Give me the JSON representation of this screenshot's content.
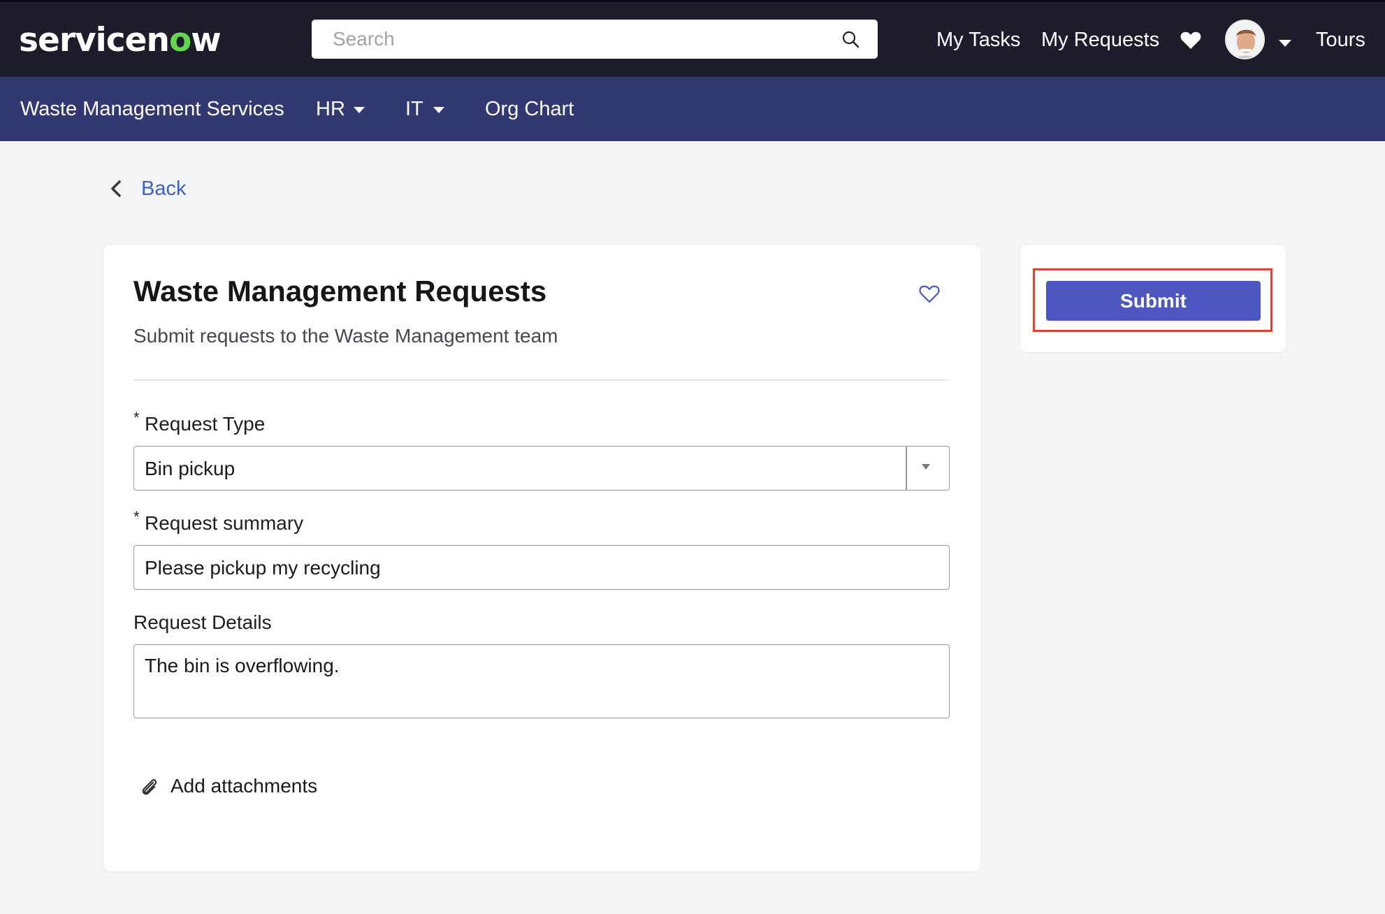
{
  "header": {
    "logo_text_a": "servicen",
    "logo_text_b": "o",
    "logo_text_c": "w",
    "search_placeholder": "Search",
    "links": {
      "tasks": "My Tasks",
      "requests": "My Requests",
      "tours": "Tours"
    }
  },
  "nav": {
    "items": [
      {
        "label": "Waste Management Services"
      },
      {
        "label": "HR"
      },
      {
        "label": "IT"
      },
      {
        "label": "Org Chart"
      }
    ]
  },
  "back_label": "Back",
  "form": {
    "title": "Waste Management Requests",
    "subtitle": "Submit requests to the Waste Management team",
    "required_mark": "*",
    "request_type": {
      "label": "Request Type",
      "value": "Bin pickup"
    },
    "request_summary": {
      "label": "Request summary",
      "value": "Please pickup my recycling"
    },
    "request_details": {
      "label": "Request Details",
      "value": "The bin is overflowing."
    },
    "attachments_label": "Add attachments"
  },
  "submit_label": "Submit",
  "colors": {
    "topbar": "#1c1c2a",
    "navbar": "#323872",
    "accent": "#4d57c1",
    "link": "#3e5fcb",
    "highlight": "#e0412d",
    "logo_accent": "#62d84e"
  },
  "icons": [
    "search-icon",
    "heart-icon",
    "avatar",
    "chevron-down-icon",
    "chevron-left-icon",
    "favorite-heart-icon",
    "paperclip-icon"
  ]
}
